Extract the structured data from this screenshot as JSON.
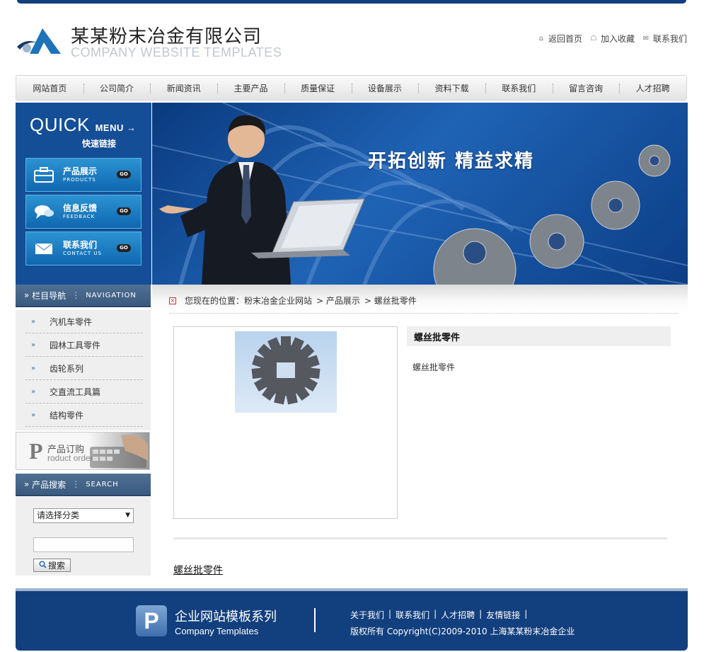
{
  "header": {
    "company_cn": "某某粉末冶金有限公司",
    "company_en": "COMPANY WEBSITE TEMPLATES",
    "links": [
      {
        "label": "返回首页",
        "icon": "home-icon"
      },
      {
        "label": "加入收藏",
        "icon": "favorite-icon"
      },
      {
        "label": "联系我们",
        "icon": "contact-icon"
      }
    ]
  },
  "nav": [
    "网站首页",
    "公司简介",
    "新闻资讯",
    "主要产品",
    "质量保证",
    "设备展示",
    "资料下载",
    "联系我们",
    "留言咨询",
    "人才招聘"
  ],
  "quick": {
    "title_big": "QUICK",
    "title_small": "MENU →",
    "subtitle": "快速链接",
    "go_label": "GO",
    "buttons": [
      {
        "cn": "产品展示",
        "en": "PRODUCTS",
        "icon": "products-icon"
      },
      {
        "cn": "信息反馈",
        "en": "FEEDBACK",
        "icon": "feedback-icon"
      },
      {
        "cn": "联系我们",
        "en": "CONTACT US",
        "icon": "mail-icon"
      }
    ]
  },
  "banner": {
    "slogan": "开拓创新 精益求精"
  },
  "sidebar": {
    "nav_title": "栏目导航",
    "nav_title_en": "NAVIGATION",
    "categories": [
      "汽机车零件",
      "园林工具零件",
      "齿轮系列",
      "交直流工具篇",
      "结构零件"
    ],
    "order_p": "P",
    "order_cn": "产品订购",
    "order_en": "roduct order",
    "search_title": "产品搜索",
    "search_title_en": "SEARCH",
    "select_value": "请选择分类",
    "search_button": "搜索"
  },
  "breadcrumb": {
    "prefix": "您现在的位置：",
    "items": [
      "粉末冶金企业网站",
      "> 产品展示",
      "> 螺丝批零件"
    ]
  },
  "product": {
    "title": "螺丝批零件",
    "description": "螺丝批零件",
    "link": "螺丝批零件"
  },
  "footer": {
    "logo_letter": "P",
    "series_cn": "企业网站模板系列",
    "series_en": "Company Templates",
    "links": [
      "关于我们",
      "|",
      "联系我们",
      "|",
      "人才招聘",
      "|",
      "友情链接",
      "|"
    ],
    "copyright": "版权所有  Copyright(C)2009-2010 上海某某粉末冶金企业"
  }
}
